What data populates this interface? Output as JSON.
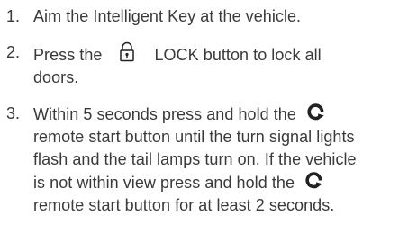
{
  "steps": [
    {
      "number": "1.",
      "lines": [
        "Aim the Intelligent Key at the vehicle."
      ]
    },
    {
      "number": "2.",
      "line1_before_icon": "Press the",
      "icon": "lock-icon",
      "line1_after_icon": "LOCK button to lock all",
      "line2": "doors."
    },
    {
      "number": "3.",
      "line1_before_icon": "Within 5 seconds press and hold the",
      "icon_a": "remote-start-icon",
      "line2": "remote start button until the turn signal lights",
      "line3": "flash and the tail lamps turn on. If the vehicle",
      "line4_before_icon": "is not within view press and hold the",
      "icon_b": "remote-start-icon",
      "line5": "remote start button for at least 2 seconds."
    }
  ],
  "colors": {
    "text": "#3a3a3a",
    "icon": "#222222"
  }
}
